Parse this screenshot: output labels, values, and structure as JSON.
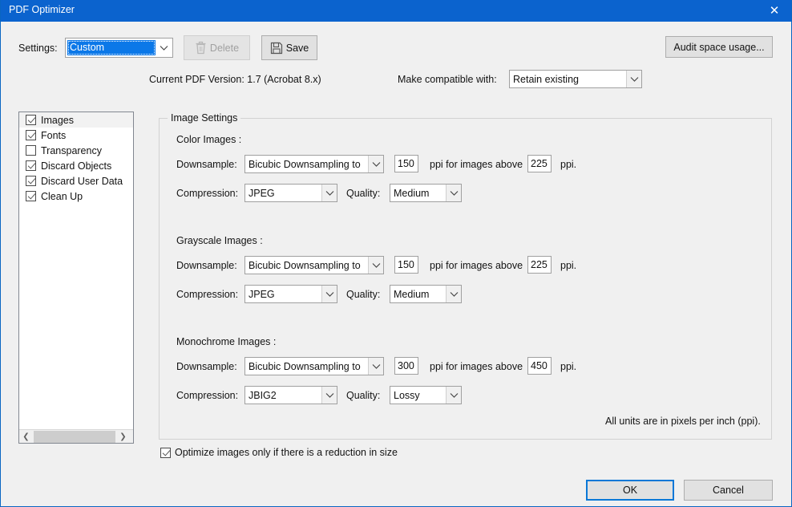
{
  "window": {
    "title": "PDF Optimizer",
    "close_icon": "close-icon",
    "accent_color": "#0b63ce",
    "background_color": "#f0f0f0"
  },
  "toolbar": {
    "settings_label": "Settings:",
    "settings_value": "Custom",
    "delete_label": "Delete",
    "delete_icon": "trash-icon",
    "save_label": "Save",
    "save_icon": "floppy-disk-icon",
    "audit_label": "Audit space usage...",
    "version_text": "Current PDF Version: 1.7 (Acrobat 8.x)",
    "compatible_label": "Make compatible with:",
    "compatible_value": "Retain existing"
  },
  "panel_list": {
    "items": [
      {
        "label": "Images",
        "checked": true,
        "selected": true
      },
      {
        "label": "Fonts",
        "checked": true,
        "selected": false
      },
      {
        "label": "Transparency",
        "checked": false,
        "selected": false
      },
      {
        "label": "Discard Objects",
        "checked": true,
        "selected": false
      },
      {
        "label": "Discard User Data",
        "checked": true,
        "selected": false
      },
      {
        "label": "Clean Up",
        "checked": true,
        "selected": false
      }
    ],
    "scroll_left_icon": "chevron-left-icon",
    "scroll_right_icon": "chevron-right-icon"
  },
  "image_settings": {
    "legend": "Image Settings",
    "labels": {
      "downsample": "Downsample:",
      "compression": "Compression:",
      "quality": "Quality:",
      "ppi_above": "ppi for images above",
      "ppi_suffix": "ppi."
    },
    "units_note": "All units are in pixels per inch (ppi).",
    "sections": [
      {
        "title": "Color Images :",
        "downsample_method": "Bicubic Downsampling to",
        "downsample_ppi": "150",
        "threshold_ppi": "225",
        "compression": "JPEG",
        "quality": "Medium"
      },
      {
        "title": "Grayscale Images :",
        "downsample_method": "Bicubic Downsampling to",
        "downsample_ppi": "150",
        "threshold_ppi": "225",
        "compression": "JPEG",
        "quality": "Medium"
      },
      {
        "title": "Monochrome Images :",
        "downsample_method": "Bicubic Downsampling to",
        "downsample_ppi": "300",
        "threshold_ppi": "450",
        "compression": "JBIG2",
        "quality": "Lossy"
      }
    ]
  },
  "footer": {
    "optimize_checkbox_label": "Optimize images only if there is a reduction in size",
    "optimize_checked": true,
    "ok_label": "OK",
    "cancel_label": "Cancel"
  }
}
